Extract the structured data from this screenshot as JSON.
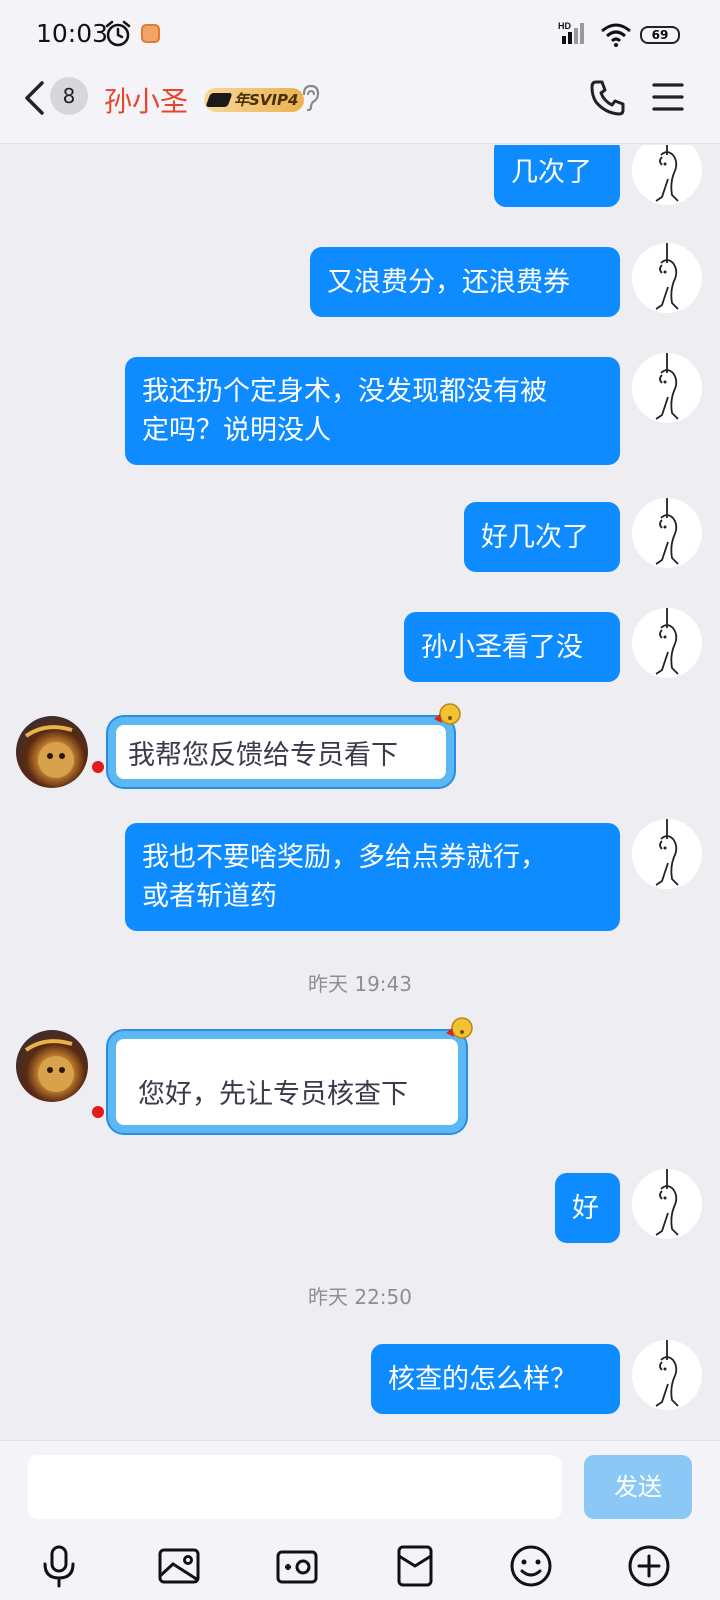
{
  "status_bar": {
    "time": "10:03",
    "network": "HD",
    "battery": "69"
  },
  "header": {
    "unread_count": "8",
    "contact_name": "孙小圣",
    "vip_label": "年SVIP4"
  },
  "messages": [
    {
      "from": "me",
      "text": "几次了"
    },
    {
      "from": "me",
      "text": "又浪费分，还浪费券"
    },
    {
      "from": "me",
      "lines": [
        "我还扔个定身术，没发现都没有被",
        "定吗？说明没人"
      ]
    },
    {
      "from": "me",
      "text": "好几次了"
    },
    {
      "from": "me",
      "text": "孙小圣看了没"
    },
    {
      "from": "them",
      "text": "我帮您反馈给专员看下"
    },
    {
      "from": "me",
      "lines": [
        "我也不要啥奖励，多给点券就行，",
        "或者斩道药"
      ]
    },
    {
      "type": "timestamp",
      "text": "昨天 19:43"
    },
    {
      "from": "them",
      "text": "您好，先让专员核查下"
    },
    {
      "from": "me",
      "text": "好"
    },
    {
      "type": "timestamp",
      "text": "昨天 22:50"
    },
    {
      "from": "me",
      "text": "核查的怎么样？"
    }
  ],
  "input": {
    "value": "",
    "send_label": "发送"
  },
  "toolbar": [
    "mic-icon",
    "image-icon",
    "camera-icon",
    "red-packet-icon",
    "emoji-icon",
    "plus-icon"
  ],
  "colors": {
    "outgoing_bubble": "#0d8bff",
    "incoming_border": "#5cb8f4",
    "name": "#e8452c",
    "send_disabled": "#8cc8f6"
  }
}
